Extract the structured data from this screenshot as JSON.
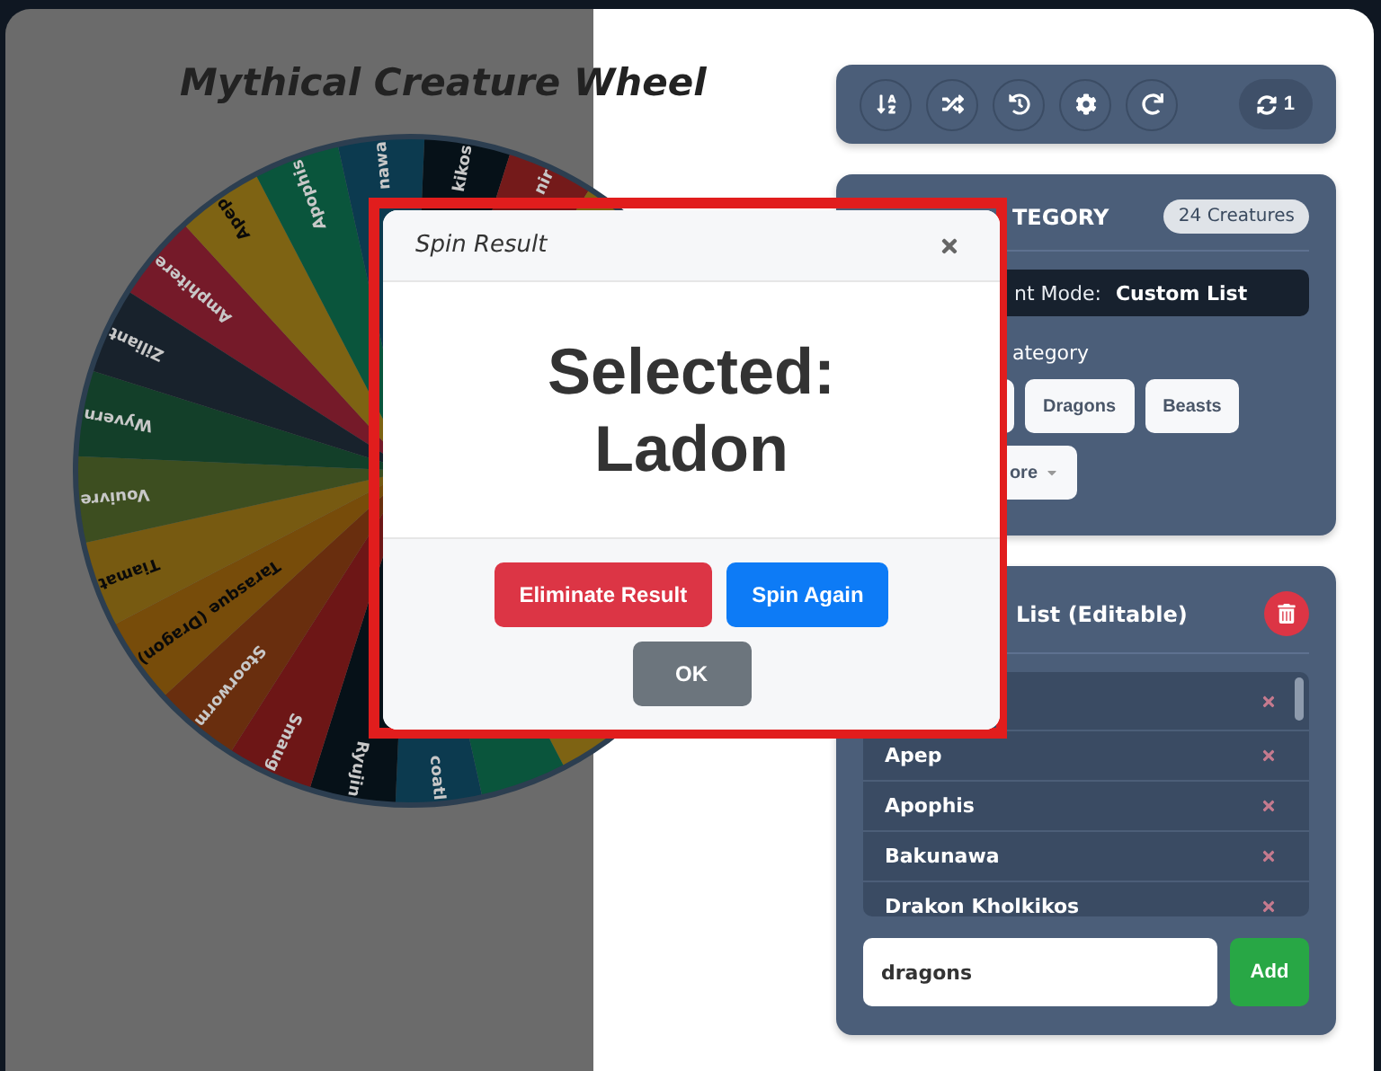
{
  "title": "Mythical Creature Wheel",
  "wheel": {
    "top_segments": [
      {
        "label": "Amphitere",
        "color": "#751a29"
      },
      {
        "label": "Apep",
        "color": "#7e6313"
      },
      {
        "label": "Apophis",
        "color": "#0a553c"
      },
      {
        "label": "nawa",
        "color": "#0c3a4f"
      },
      {
        "label": "kikos",
        "color": "#061118"
      },
      {
        "label": "nir",
        "color": "#741a1a"
      },
      {
        "color": "#7e6313"
      }
    ],
    "bottom_segments": [
      {
        "color": "#7e6313"
      },
      {
        "color": "#0a553c"
      },
      {
        "label": "coatl",
        "color": "#0c3a4f"
      },
      {
        "label": "Ryujin",
        "color": "#061118"
      },
      {
        "label": "Smaug",
        "color": "#6d1616"
      },
      {
        "label": "Stoorworm",
        "color": "#692e0e"
      },
      {
        "label": "Tarasque (Dragon)",
        "color": "#774c0a"
      },
      {
        "label": "Tiamat",
        "color": "#775a11"
      },
      {
        "label": "Vouivre",
        "color": "#3d4e20"
      },
      {
        "label": "Wyvern",
        "color": "#133f29"
      },
      {
        "label": "Ziliant",
        "color": "#18222c"
      }
    ]
  },
  "spin_count": "1",
  "category_panel": {
    "heading": "TEGORY",
    "count_badge": "24 Creatures",
    "mode_label": "nt Mode:",
    "mode_value": "Custom List",
    "section_label": "ategory",
    "options": [
      {
        "kind": "covered"
      },
      {
        "kind": "text",
        "label": "Dragons"
      },
      {
        "kind": "text",
        "label": "Beasts"
      }
    ],
    "more_button": "ore"
  },
  "custom_list": {
    "heading": "List (Editable)",
    "items": [
      {
        "kind": "covered"
      },
      {
        "kind": "text",
        "label": "Apep"
      },
      {
        "kind": "text",
        "label": "Apophis"
      },
      {
        "kind": "text",
        "label": "Bakunawa"
      },
      {
        "kind": "text",
        "label": "Drakon Kholkikos"
      }
    ],
    "input": {
      "value": "dragons"
    },
    "add_button": "Add"
  },
  "modal": {
    "title": "Spin Result",
    "result": "Selected: Ladon",
    "buttons": [
      {
        "label": "Eliminate Result",
        "kind": "danger"
      },
      {
        "label": "Spin Again",
        "kind": "primary"
      },
      {
        "label": "OK",
        "kind": "secondary"
      }
    ]
  }
}
